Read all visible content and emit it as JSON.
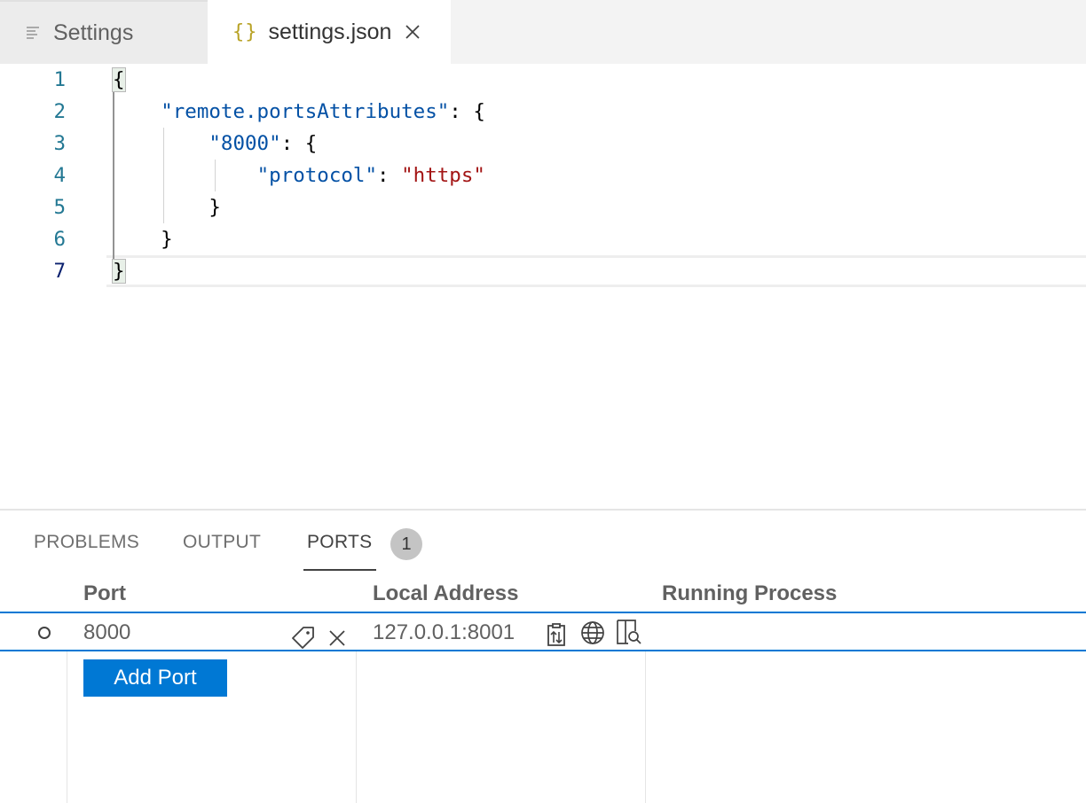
{
  "tabs": [
    {
      "label": "Settings",
      "icon": "settings-list-icon",
      "active": false
    },
    {
      "label": "settings.json",
      "icon": "json-braces-icon",
      "icon_glyph": "{}",
      "active": true
    }
  ],
  "editor": {
    "line_numbers": [
      "1",
      "2",
      "3",
      "4",
      "5",
      "6",
      "7"
    ],
    "lines": [
      {
        "parts": [
          {
            "t": "{",
            "c": "p"
          }
        ]
      },
      {
        "parts": [
          {
            "t": "    ",
            "c": "p"
          },
          {
            "t": "\"remote.portsAttributes\"",
            "c": "k"
          },
          {
            "t": ": {",
            "c": "p"
          }
        ]
      },
      {
        "parts": [
          {
            "t": "        ",
            "c": "p"
          },
          {
            "t": "\"8000\"",
            "c": "k"
          },
          {
            "t": ": {",
            "c": "p"
          }
        ]
      },
      {
        "parts": [
          {
            "t": "            ",
            "c": "p"
          },
          {
            "t": "\"protocol\"",
            "c": "k"
          },
          {
            "t": ": ",
            "c": "p"
          },
          {
            "t": "\"https\"",
            "c": "s"
          }
        ]
      },
      {
        "parts": [
          {
            "t": "        }",
            "c": "p"
          }
        ]
      },
      {
        "parts": [
          {
            "t": "    }",
            "c": "p"
          }
        ]
      },
      {
        "parts": [
          {
            "t": "}",
            "c": "p"
          }
        ]
      }
    ],
    "active_line": "7"
  },
  "panel": {
    "tabs": {
      "problems": "PROBLEMS",
      "output": "OUTPUT",
      "ports": "PORTS"
    },
    "ports_badge": "1",
    "columns": {
      "port": "Port",
      "local_address": "Local Address",
      "running_process": "Running Process"
    },
    "rows": [
      {
        "port": "8000",
        "local_address": "127.0.0.1:8001",
        "running_process": ""
      }
    ],
    "add_port_label": "Add Port"
  },
  "colors": {
    "accent": "#0078d4",
    "json_key": "#0451a5",
    "json_string": "#a31515"
  }
}
